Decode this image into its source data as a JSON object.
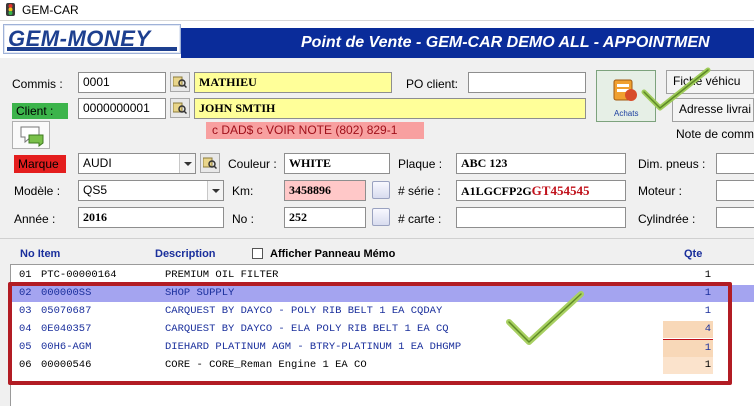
{
  "window": {
    "title": "GEM-CAR"
  },
  "banner": {
    "logo": "GEM-MONEY",
    "title": "Point de Vente - GEM-CAR DEMO ALL  - APPOINTMEN"
  },
  "form": {
    "commis_label": "Commis :",
    "commis_code": "0001",
    "commis_name": "MATHIEU",
    "po_label": "PO client:",
    "po_value": "",
    "client_label": "Client :",
    "client_code": "0000000001",
    "client_name": "JOHN SMTIH",
    "client_note": "c DAD$ c VOIR NOTE (802) 829-1",
    "achats_label": "Achats",
    "fiche_label": "Fiche véhicu",
    "adresse_label": "Adresse livrai",
    "note_label": "Note de comm",
    "marque_label": "Marque",
    "marque_value": "AUDI",
    "couleur_label": "Couleur :",
    "couleur_value": "WHITE",
    "plaque_label": "Plaque :",
    "plaque_value": "ABC 123",
    "dim_label": "Dim. pneus :",
    "modele_label": "Modèle :",
    "modele_value": "QS5",
    "km_label": "Km:",
    "km_value": "3458896",
    "serie_label": "# série :",
    "serie_prefix": "A1LGCFP2G",
    "serie_suffix": "GT454545",
    "moteur_label": "Moteur :",
    "annee_label": "Année :",
    "annee_value": "2016",
    "no_label": "No :",
    "no_value": "252",
    "carte_label": "# carte :",
    "carte_value": "",
    "cylindree_label": "Cylindrée :"
  },
  "table": {
    "col_no_item": "No Item",
    "col_description": "Description",
    "memo_label": "Afficher Panneau Mémo",
    "col_qte": "Qte",
    "rows": [
      {
        "line": "01",
        "item": "PTC-00000164",
        "desc": "PREMIUM OIL FILTER",
        "qty": "1"
      },
      {
        "line": "02",
        "item": "000000SS",
        "desc": "SHOP SUPPLY",
        "qty": "1"
      },
      {
        "line": "03",
        "item": "05070687",
        "desc": "CARQUEST BY DAYCO - POLY RIB BELT 1 EA CQDAY",
        "qty": "1"
      },
      {
        "line": "04",
        "item": "0E040357",
        "desc": "CARQUEST BY DAYCO - ELA POLY RIB BELT 1 EA CQ",
        "qty": "4"
      },
      {
        "line": "05",
        "item": "00H6-AGM",
        "desc": "DIEHARD PLATINUM AGM - BTRY-PLATINUM 1 EA DHGMP",
        "qty": "1"
      },
      {
        "line": "06",
        "item": "00000546",
        "desc": "CORE - CORE_Reman Engine 1 EA CO",
        "qty": "1"
      }
    ]
  },
  "colors": {
    "banner_blue": "#0a2c9a",
    "highlight_row": "#9a9aee",
    "annotation_red": "#b21c24",
    "check_green": "#8ab84a"
  }
}
